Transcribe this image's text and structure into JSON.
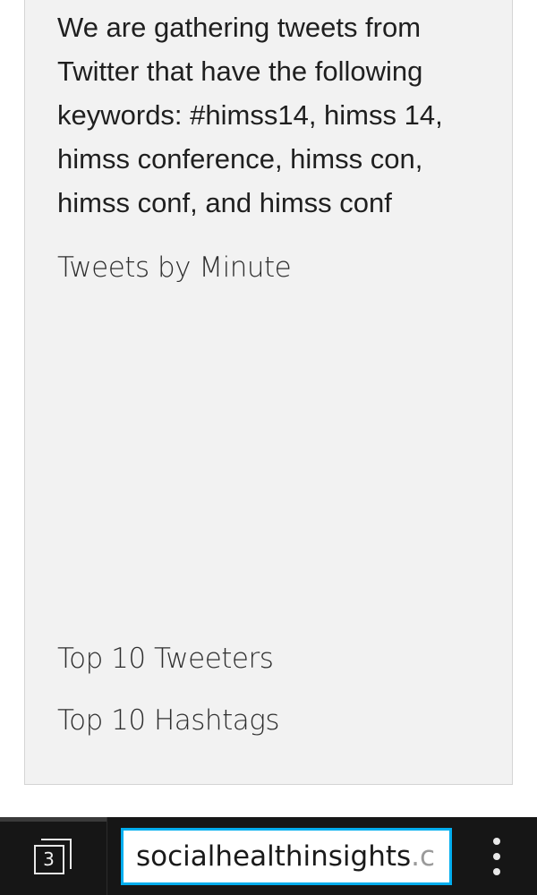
{
  "content": {
    "intro_text": "We are gathering tweets from Twitter that have the following keywords: #himss14, himss 14, himss conference, himss con, himss conf, and himss conf",
    "tweets_by_minute_heading": "Tweets by Minute",
    "top_tweeters_heading": "Top 10 Tweeters",
    "top_hashtags_heading": "Top 10 Hashtags"
  },
  "browser": {
    "tab_count": "3",
    "url_visible": "socialhealthinsights",
    "url_cut": ".c",
    "url_accent_color": "#00aeef"
  }
}
